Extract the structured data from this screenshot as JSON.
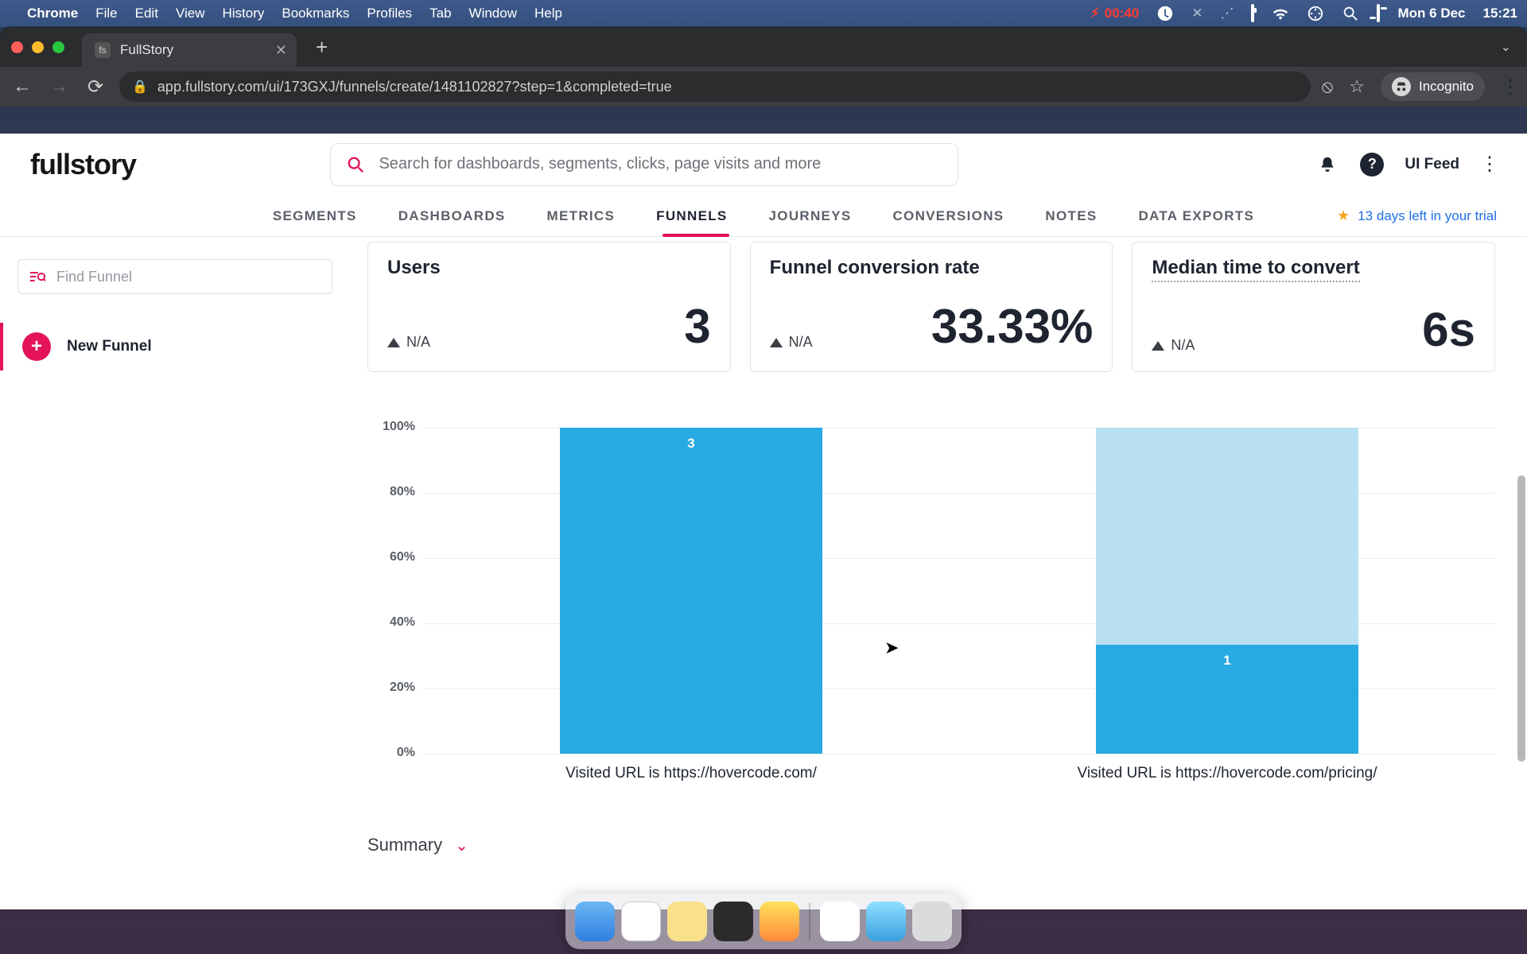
{
  "mac_menu": {
    "app": "Chrome",
    "items": [
      "File",
      "Edit",
      "View",
      "History",
      "Bookmarks",
      "Profiles",
      "Tab",
      "Window",
      "Help"
    ],
    "battery_time": "00:40",
    "date": "Mon 6 Dec",
    "clock": "15:21"
  },
  "browser": {
    "tab_title": "FullStory",
    "tab_favicon": "fs",
    "url": "app.fullstory.com/ui/173GXJ/funnels/create/1481102827?step=1&completed=true",
    "incognito_label": "Incognito"
  },
  "header": {
    "logo": "fullstory",
    "search_placeholder": "Search for dashboards, segments, clicks, page visits and more",
    "ui_feed": "UI Feed"
  },
  "nav": {
    "items": [
      "SEGMENTS",
      "DASHBOARDS",
      "METRICS",
      "FUNNELS",
      "JOURNEYS",
      "CONVERSIONS",
      "NOTES",
      "DATA EXPORTS"
    ],
    "active_index": 3,
    "trial_text": "13 days left in your trial"
  },
  "sidebar": {
    "find_placeholder": "Find Funnel",
    "new_funnel": "New Funnel"
  },
  "kpi": {
    "users_label": "Users",
    "users_delta": "N/A",
    "users_value": "3",
    "rate_label": "Funnel conversion rate",
    "rate_delta": "N/A",
    "rate_value": "33.33%",
    "median_label": "Median time to convert",
    "median_delta": "N/A",
    "median_value": "6s"
  },
  "chart_data": {
    "type": "bar",
    "ylabel_ticks": [
      "100%",
      "80%",
      "60%",
      "40%",
      "20%",
      "0%"
    ],
    "ylim": [
      0,
      100
    ],
    "steps": [
      {
        "label": "Visited URL is https://hovercode.com/",
        "ghost_pct": 100,
        "solid_pct": 100,
        "bar_label": "3"
      },
      {
        "label": "Visited URL is https://hovercode.com/pricing/",
        "ghost_pct": 100,
        "solid_pct": 33.33,
        "bar_label": "1"
      }
    ]
  },
  "summary": {
    "label": "Summary"
  },
  "colors": {
    "pink": "#e4135a",
    "bar": "#27aae1",
    "ghost": "#b8e0f2"
  }
}
